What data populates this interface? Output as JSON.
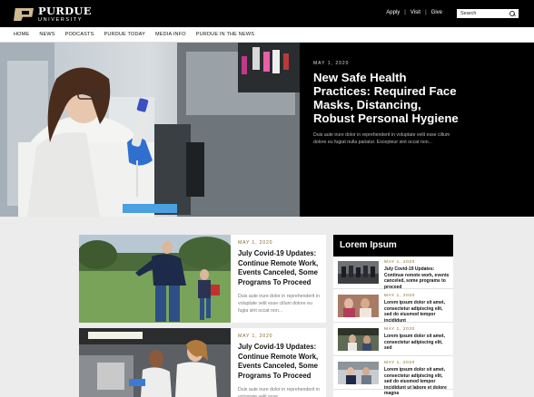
{
  "header": {
    "logo": {
      "name": "PURDUE",
      "subtitle": "UNIVERSITY"
    },
    "util_links": [
      "Apply",
      "Visit",
      "Give"
    ],
    "search_placeholder": "Search"
  },
  "nav": {
    "items": [
      "HOME",
      "NEWS",
      "PODCASTS",
      "PURDUE TODAY",
      "MEDIA INFO",
      "PURDUE IN THE NEWS"
    ]
  },
  "hero": {
    "date": "MAY 1, 2020",
    "title": "New Safe Health Practices: Required Face Masks, Distancing, Robust Personal Hygiene",
    "excerpt": "Duis aute irure dolor in reprehenderit in voluptate velit esse cillum dolore eu fugiat nulla pariatur. Excepteur sint occat non..."
  },
  "articles": [
    {
      "date": "MAY 1, 2020",
      "title": "July Covid-19 Updates: Continue Remote Work, Events Canceled, Some Programs To Proceed",
      "excerpt": "Duis aute irure dolor in reprehenderit in voluptate velit esse cillum dolore eu fugia sint occat non..."
    },
    {
      "date": "MAY 1, 2020",
      "title": "July Covid-19 Updates: Continue Remote Work, Events Canceled, Some Programs To Proceed",
      "excerpt": "Duis aute irure dolor in reprehenderit in voluptate velit esse"
    }
  ],
  "sidebar": {
    "title": "Lorem Ipsum",
    "items": [
      {
        "date": "MAY 1, 2020",
        "title": "July Covid-19 Updates: Continue remote work, events canceled, some programs to proceed"
      },
      {
        "date": "MAY 1, 2020",
        "title": "Lorem ipsum dolor sit amet, consectetur adipiscing elit, sed do eiusmod tempor incididunt"
      },
      {
        "date": "MAY 1, 2020",
        "title": "Lorem ipsum dolor sit amet, consectetur adipiscing elit, sed"
      },
      {
        "date": "MAY 1, 2020",
        "title": "Lorem ipsum dolor sit amet, consectetur adipiscing elit, sed do eiusmod tempor incididunt ut labore et dolore magna"
      }
    ]
  },
  "colors": {
    "brand_gold": "#cfb991",
    "date_gold": "#8a6a2c",
    "black": "#000000"
  },
  "icons": {
    "search": "magnifier-icon"
  }
}
